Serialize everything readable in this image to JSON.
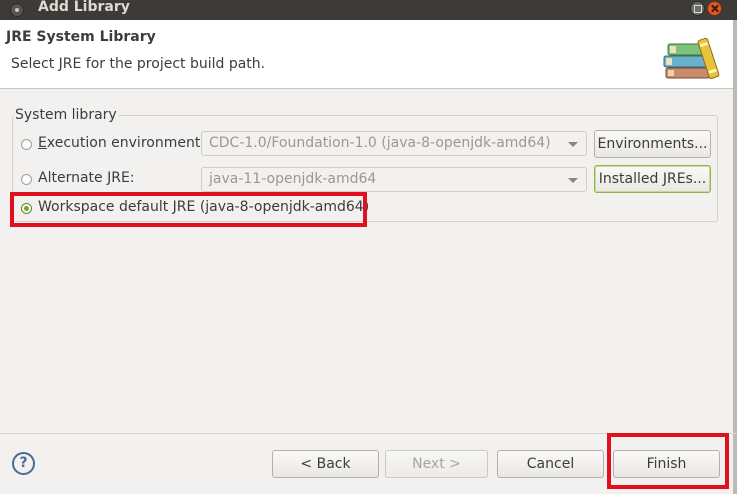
{
  "window": {
    "title": "Add Library"
  },
  "header": {
    "title": "JRE System Library",
    "subtitle": "Select JRE for the project build path."
  },
  "group": {
    "legend": "System library",
    "options": [
      {
        "label_first": "E",
        "label_rest": "xecution environment:",
        "selected": false,
        "combo_value": "CDC-1.0/Foundation-1.0 (java-8-openjdk-amd64)",
        "button": "Environments...",
        "enabled": false
      },
      {
        "label": "Alternate JRE:",
        "selected": false,
        "combo_value": "java-11-openjdk-amd64",
        "button": "Installed JREs...",
        "enabled": false
      },
      {
        "label": "Workspace default JRE (java-8-openjdk-amd64)",
        "selected": true
      }
    ]
  },
  "footer": {
    "help_glyph": "?",
    "back": "< Back",
    "next": "Next >",
    "cancel": "Cancel",
    "finish": "Finish"
  },
  "colors": {
    "highlight": "#e0101e",
    "accent_green": "#6da82a",
    "titlebar": "#3c3b37"
  }
}
